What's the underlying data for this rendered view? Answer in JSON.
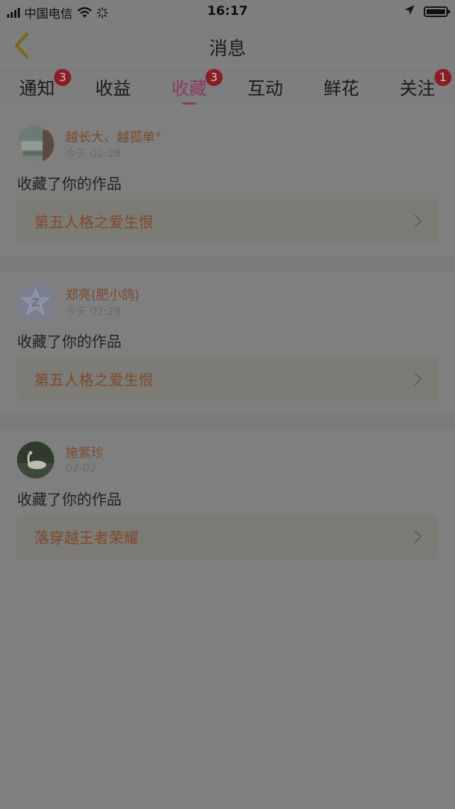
{
  "status_bar": {
    "carrier": "中国电信",
    "time": "16:17"
  },
  "nav": {
    "title": "消息"
  },
  "tabs": [
    {
      "label": "通知",
      "badge": "3"
    },
    {
      "label": "收益",
      "badge": ""
    },
    {
      "label": "收藏",
      "badge": "3",
      "active": true
    },
    {
      "label": "互动",
      "badge": ""
    },
    {
      "label": "鲜花",
      "badge": ""
    },
    {
      "label": "关注",
      "badge": "1"
    }
  ],
  "messages": [
    {
      "user": "越长大、越孤单°",
      "time": "今天 02:28",
      "action": "收藏了你的作品",
      "work": "第五人格之爱生恨"
    },
    {
      "user": "郑亮(肥小鸽)",
      "time": "今天 02:28",
      "action": "收藏了你的作品",
      "work": "第五人格之爱生恨"
    },
    {
      "user": "施紫珍",
      "time": "02-02",
      "action": "收藏了你的作品",
      "work": "落穿越王者荣耀"
    }
  ],
  "colors": {
    "accent": "#8a3a63",
    "badge": "#8b1d24",
    "link_text": "#7d4a2c",
    "back_icon": "#7a6a1e"
  }
}
